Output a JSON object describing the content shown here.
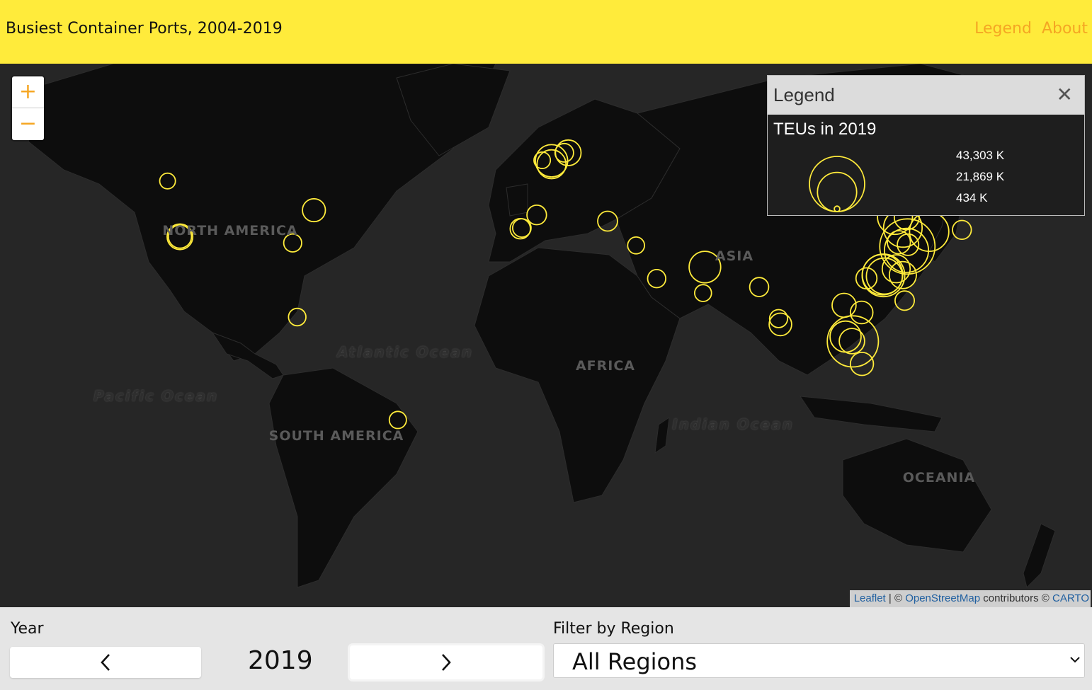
{
  "header": {
    "title": "Busiest Container Ports, 2004-2019",
    "nav": [
      "Legend",
      "About"
    ]
  },
  "colors": {
    "header_bg": "#ffeb3b",
    "accent": "#f5a623",
    "marker": "#ffeb3b",
    "map_land": "#0d0d0d",
    "map_water": "#262626"
  },
  "map": {
    "zoom_in_icon": "plus-icon",
    "zoom_out_icon": "minus-icon",
    "continents": [
      "NORTH AMERICA",
      "SOUTH AMERICA",
      "AFRICA",
      "ASIA",
      "OCEANIA"
    ],
    "oceans": [
      "Atlantic Ocean",
      "Pacific Ocean",
      "Indian Ocean"
    ],
    "attribution": {
      "leaflet": "Leaflet",
      "sep1": " | © ",
      "osm": "OpenStreetMap",
      "contrib": " contributors © ",
      "carto": "CARTO"
    }
  },
  "legend": {
    "title": "Legend",
    "close_icon": "close-icon",
    "subtitle": "TEUs in 2019",
    "values": [
      "43,303 K",
      "21,869 K",
      "434 K"
    ],
    "values_k": [
      43303,
      21869,
      434
    ]
  },
  "ports": [
    {
      "lon": -122.3,
      "lat": 47.6,
      "teu_k": 3500
    },
    {
      "lon": -118.2,
      "lat": 33.7,
      "teu_k": 9300
    },
    {
      "lon": -118.2,
      "lat": 33.75,
      "teu_k": 7600
    },
    {
      "lon": -74.0,
      "lat": 40.7,
      "teu_k": 7500
    },
    {
      "lon": -81.0,
      "lat": 32.0,
      "teu_k": 4600
    },
    {
      "lon": -79.5,
      "lat": 9.3,
      "teu_k": 4300
    },
    {
      "lon": -46.3,
      "lat": -23.9,
      "teu_k": 4200
    },
    {
      "lon": 4.4,
      "lat": 51.9,
      "teu_k": 14800
    },
    {
      "lon": 4.4,
      "lat": 51.2,
      "teu_k": 11900
    },
    {
      "lon": 9.9,
      "lat": 53.5,
      "teu_k": 9300
    },
    {
      "lon": 8.6,
      "lat": 53.5,
      "teu_k": 4900
    },
    {
      "lon": 1.3,
      "lat": 52.0,
      "teu_k": 3800
    },
    {
      "lon": -0.5,
      "lat": 39.5,
      "teu_k": 5400
    },
    {
      "lon": -5.4,
      "lat": 36.1,
      "teu_k": 4800
    },
    {
      "lon": -5.9,
      "lat": 35.9,
      "teu_k": 5800
    },
    {
      "lon": 22.9,
      "lat": 37.9,
      "teu_k": 5600
    },
    {
      "lon": 32.3,
      "lat": 31.3,
      "teu_k": 4000
    },
    {
      "lon": 39.1,
      "lat": 21.5,
      "teu_k": 4700
    },
    {
      "lon": 55.0,
      "lat": 25.0,
      "teu_k": 14100
    },
    {
      "lon": 54.4,
      "lat": 17.0,
      "teu_k": 4000
    },
    {
      "lon": 72.9,
      "lat": 18.9,
      "teu_k": 5100
    },
    {
      "lon": 79.9,
      "lat": 6.9,
      "teu_k": 7200
    },
    {
      "lon": 79.3,
      "lat": 8.8,
      "teu_k": 4600
    },
    {
      "lon": 103.8,
      "lat": 1.3,
      "teu_k": 37200
    },
    {
      "lon": 101.4,
      "lat": 2.9,
      "teu_k": 13600
    },
    {
      "lon": 103.5,
      "lat": 1.4,
      "teu_k": 9100
    },
    {
      "lon": 100.9,
      "lat": 13.1,
      "teu_k": 8100
    },
    {
      "lon": 106.7,
      "lat": 10.8,
      "teu_k": 7200
    },
    {
      "lon": 106.8,
      "lat": -6.1,
      "teu_k": 7600
    },
    {
      "lon": 120.9,
      "lat": 14.6,
      "teu_k": 5300
    },
    {
      "lon": 121.8,
      "lat": 31.0,
      "teu_k": 43303
    },
    {
      "lon": 121.5,
      "lat": 29.9,
      "teu_k": 27500
    },
    {
      "lon": 113.9,
      "lat": 22.5,
      "teu_k": 25800
    },
    {
      "lon": 113.6,
      "lat": 22.7,
      "teu_k": 23200
    },
    {
      "lon": 114.2,
      "lat": 22.3,
      "teu_k": 18300
    },
    {
      "lon": 120.3,
      "lat": 36.1,
      "teu_k": 21000
    },
    {
      "lon": 117.7,
      "lat": 39.0,
      "teu_k": 17300
    },
    {
      "lon": 129.0,
      "lat": 35.1,
      "teu_k": 21900
    },
    {
      "lon": 118.1,
      "lat": 24.5,
      "teu_k": 11100
    },
    {
      "lon": 120.3,
      "lat": 22.6,
      "teu_k": 10400
    },
    {
      "lon": 121.6,
      "lat": 38.9,
      "teu_k": 8800
    },
    {
      "lon": 119.0,
      "lat": 32.2,
      "teu_k": 7600
    },
    {
      "lon": 122.0,
      "lat": 31.5,
      "teu_k": 6500
    },
    {
      "lon": 108.3,
      "lat": 21.6,
      "teu_k": 6200
    },
    {
      "lon": 139.8,
      "lat": 35.6,
      "teu_k": 5000
    }
  ],
  "controls": {
    "year_label": "Year",
    "year_value": "2019",
    "prev_icon": "chevron-left-icon",
    "next_icon": "chevron-right-icon",
    "region_label": "Filter by Region",
    "region_selected": "All Regions",
    "dropdown_icon": "chevron-down-icon"
  }
}
